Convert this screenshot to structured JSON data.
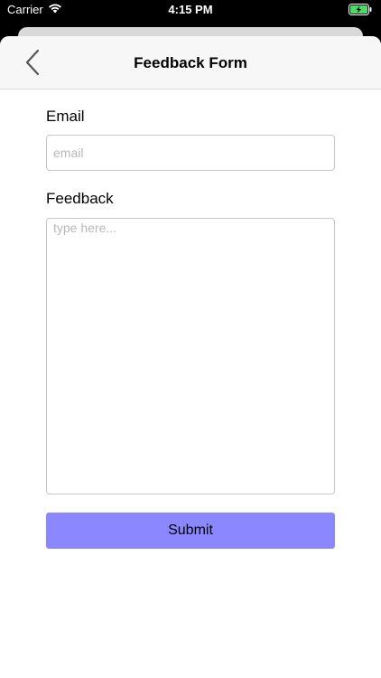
{
  "status_bar": {
    "carrier": "Carrier",
    "time": "4:15 PM",
    "battery_color": "#4cd964"
  },
  "nav": {
    "title": "Feedback Form",
    "back_icon": "chevron-left-icon"
  },
  "form": {
    "email_label": "Email",
    "email_placeholder": "email",
    "email_value": "",
    "feedback_label": "Feedback",
    "feedback_placeholder": "type here...",
    "feedback_value": "",
    "submit_label": "Submit",
    "submit_color": "#8a87ff"
  }
}
